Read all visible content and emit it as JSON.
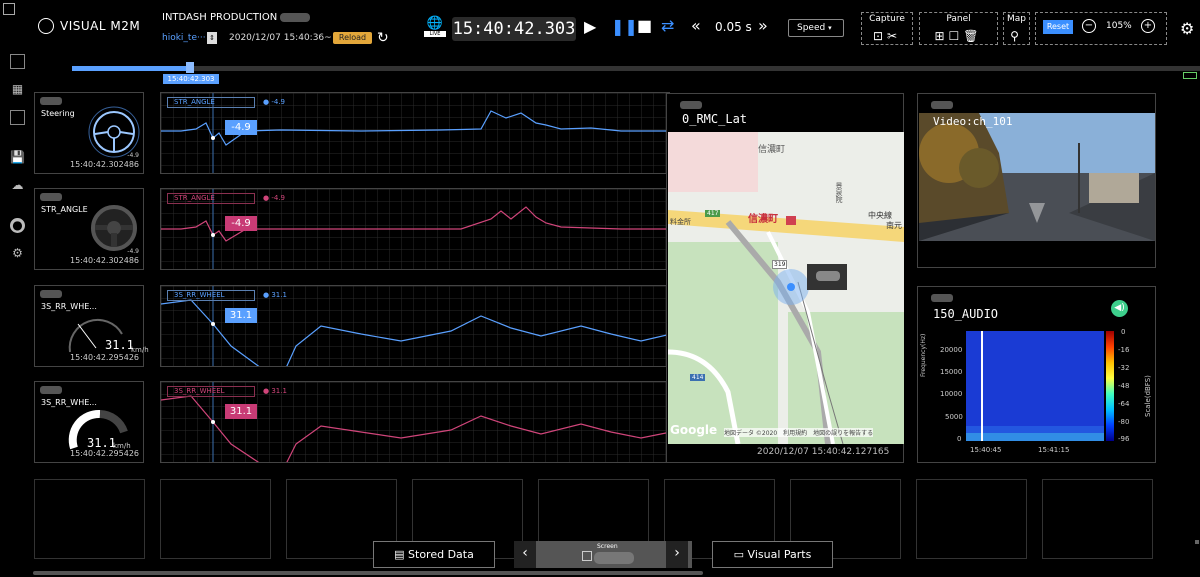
{
  "app": {
    "logo_text": "VISUAL M2M",
    "project": "INTDASH PRODUCTION",
    "user": "hioki_te···",
    "date": "2020/12/07 15:40:36~",
    "reload_label": "Reload"
  },
  "playback": {
    "time": "15:40:42.303",
    "step": "0.05 s",
    "speed_label": "Speed",
    "live_label": "LIVE"
  },
  "toolbar": {
    "capture_label": "Capture",
    "panel_label": "Panel",
    "map_label": "Map",
    "reset_label": "Reset",
    "zoom": "105%"
  },
  "timeline": {
    "current": "15:40:42.303",
    "progress": 0.105
  },
  "gauges": [
    {
      "title": "Steering",
      "value": "-4.9",
      "timestamp": "15:40:42.302486"
    },
    {
      "title": "STR_ANGLE",
      "value": "-4.9",
      "timestamp": "15:40:42.302486"
    },
    {
      "title": "3S_RR_WHE...",
      "value": "31.1",
      "unit": "km/h",
      "timestamp": "15:40:42.295426"
    },
    {
      "title": "3S_RR_WHE...",
      "value": "31.1",
      "unit": "km/h",
      "timestamp": "15:40:42.295426"
    }
  ],
  "charts": [
    {
      "legend": "STR_ANGLE",
      "value": "-4.9",
      "tag": "-4.9",
      "color": "#5aa0ff"
    },
    {
      "legend": "STR_ANGLE",
      "value": "-4.9",
      "tag": "-4.9",
      "color": "#d0457a"
    },
    {
      "legend": "3S_RR_WHEEL",
      "value": "31.1",
      "tag": "31.1",
      "color": "#5aa0ff"
    },
    {
      "legend": "3S_RR_WHEEL",
      "value": "31.1",
      "tag": "31.1",
      "color": "#d0457a"
    }
  ],
  "map": {
    "title": "0_RMC_Lat",
    "timestamp": "2020/12/07 15:40:42.127165",
    "google": "Google",
    "attribution": "地図データ ©2020　利用規約　地図の誤りを報告する",
    "labels": [
      "信濃町",
      "信濃町",
      "料金所",
      "中央線",
      "南元",
      "417",
      "319",
      "414",
      "景泉院"
    ]
  },
  "video": {
    "title": "Video:ch_101"
  },
  "audio": {
    "title": "150_AUDIO",
    "y_label": "Frequency(Hz)",
    "y_ticks": [
      "20000",
      "15000",
      "10000",
      "5000",
      "0"
    ],
    "x_ticks": [
      "15:40:45",
      "15:41:15"
    ],
    "scale_label": "Scale(dBFS)",
    "scale_ticks": [
      "0",
      "-16",
      "-32",
      "-48",
      "-64",
      "-80",
      "-96"
    ]
  },
  "bottom": {
    "stored_data": "Stored Data",
    "screen": "Screen",
    "visual_parts": "Visual Parts"
  }
}
